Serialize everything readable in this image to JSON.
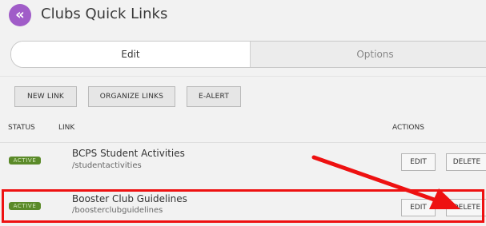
{
  "header": {
    "title": "Clubs Quick Links",
    "back_icon": "chevron-double-left-icon",
    "accent_color": "#a05cc8"
  },
  "tabs": [
    {
      "label": "Edit",
      "active": true
    },
    {
      "label": "Options",
      "active": false
    }
  ],
  "toolbar": {
    "new_link": "NEW LINK",
    "organize_links": "ORGANIZE LINKS",
    "e_alert": "E-ALERT"
  },
  "table": {
    "columns": {
      "status": "STATUS",
      "link": "LINK",
      "actions": "ACTIONS"
    },
    "rows": [
      {
        "status": "ACTIVE",
        "name": "BCPS Student Activities",
        "path": "/studentactivities",
        "edit": "EDIT",
        "delete": "DELETE"
      },
      {
        "status": "ACTIVE",
        "name": "Booster Club Guidelines",
        "path": "/boosterclubguidelines",
        "edit": "EDIT",
        "delete": "DELETE"
      }
    ]
  },
  "annotation": {
    "highlight_color": "#ee1111",
    "arrow_icon": "red-arrow"
  }
}
